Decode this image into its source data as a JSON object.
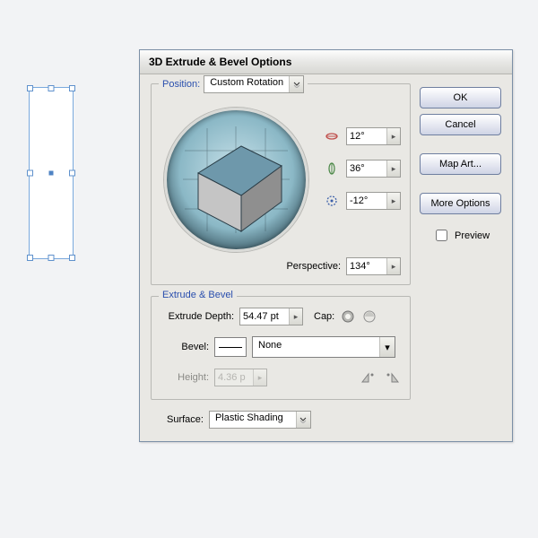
{
  "dialog": {
    "title": "3D Extrude & Bevel Options",
    "position": {
      "legend": "Position:",
      "preset": "Custom Rotation",
      "rot_x": "12°",
      "rot_y": "36°",
      "rot_z": "-12°",
      "perspective_label": "Perspective:",
      "perspective": "134°"
    },
    "extrude": {
      "legend": "Extrude & Bevel",
      "depth_label": "Extrude Depth:",
      "depth": "54.47 pt",
      "cap_label": "Cap:",
      "bevel_label": "Bevel:",
      "bevel": "None",
      "height_label": "Height:",
      "height": "4.36 p"
    },
    "surface": {
      "label": "Surface:",
      "value": "Plastic Shading"
    },
    "buttons": {
      "ok": "OK",
      "cancel": "Cancel",
      "map_art": "Map Art...",
      "more_options": "More Options",
      "preview": "Preview"
    }
  }
}
